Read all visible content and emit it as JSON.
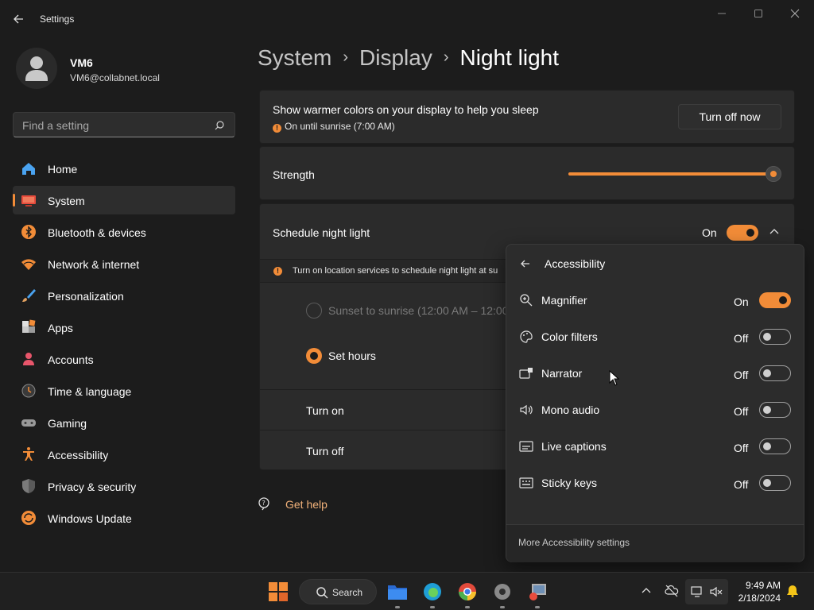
{
  "window": {
    "title": "Settings"
  },
  "profile": {
    "name": "VM6",
    "email": "VM6@collabnet.local"
  },
  "search": {
    "placeholder": "Find a setting"
  },
  "nav": {
    "items": [
      {
        "label": "Home",
        "icon": "home-icon"
      },
      {
        "label": "System",
        "icon": "system-icon",
        "active": true
      },
      {
        "label": "Bluetooth & devices",
        "icon": "bluetooth-icon"
      },
      {
        "label": "Network & internet",
        "icon": "wifi-icon"
      },
      {
        "label": "Personalization",
        "icon": "brush-icon"
      },
      {
        "label": "Apps",
        "icon": "apps-icon"
      },
      {
        "label": "Accounts",
        "icon": "accounts-icon"
      },
      {
        "label": "Time & language",
        "icon": "clock-globe-icon"
      },
      {
        "label": "Gaming",
        "icon": "gamepad-icon"
      },
      {
        "label": "Accessibility",
        "icon": "accessibility-icon"
      },
      {
        "label": "Privacy & security",
        "icon": "shield-icon"
      },
      {
        "label": "Windows Update",
        "icon": "update-icon"
      }
    ]
  },
  "breadcrumb": {
    "part1": "System",
    "part2": "Display",
    "current": "Night light"
  },
  "night_light": {
    "description": "Show warmer colors on your display to help you sleep",
    "status": "On until sunrise (7:00 AM)",
    "turn_off_button": "Turn off now",
    "strength_label": "Strength",
    "strength_value": 1.0,
    "schedule_label": "Schedule night light",
    "schedule_state": "On",
    "location_warning": "Turn on location services to schedule night light at su",
    "option_sunset": "Sunset to sunrise (12:00 AM – 12:00 A",
    "option_set_hours": "Set hours",
    "turn_on_label": "Turn on",
    "turn_off_label": "Turn off"
  },
  "get_help": "Get help",
  "flyout": {
    "title": "Accessibility",
    "items": [
      {
        "label": "Magnifier",
        "state": "On",
        "icon": "magnifier-icon"
      },
      {
        "label": "Color filters",
        "state": "Off",
        "icon": "color-filters-icon"
      },
      {
        "label": "Narrator",
        "state": "Off",
        "icon": "narrator-icon"
      },
      {
        "label": "Mono audio",
        "state": "Off",
        "icon": "mono-audio-icon"
      },
      {
        "label": "Live captions",
        "state": "Off",
        "icon": "live-captions-icon"
      },
      {
        "label": "Sticky keys",
        "state": "Off",
        "icon": "sticky-keys-icon"
      }
    ],
    "footer": "More Accessibility settings"
  },
  "taskbar": {
    "search_label": "Search",
    "time": "9:49 AM",
    "date": "2/18/2024"
  },
  "colors": {
    "accent": "#f28c38",
    "background": "#1c1c1c",
    "card": "#2b2b2b"
  }
}
